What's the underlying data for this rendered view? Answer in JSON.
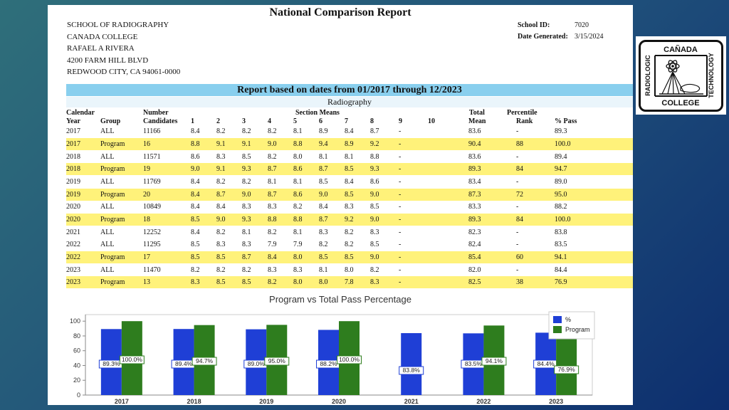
{
  "report": {
    "title": "National Comparison Report",
    "address": [
      "SCHOOL OF RADIOGRAPHY",
      "CANADA COLLEGE",
      "RAFAEL A RIVERA",
      "4200 FARM HILL BLVD",
      "REDWOOD CITY, CA 94061-0000"
    ],
    "school_id_label": "School ID:",
    "school_id": "7020",
    "date_label": "Date Generated:",
    "date": "3/15/2024",
    "banner": "Report based on dates from 01/2017 through 12/2023",
    "program_name": "Radiography"
  },
  "table": {
    "header_top": {
      "calendar": "Calendar",
      "number": "Number",
      "section_means": "Section Means",
      "total": "Total",
      "percentile": "Percentile"
    },
    "header_bottom": [
      "Year",
      "Group",
      "Candidates",
      "1",
      "2",
      "3",
      "4",
      "5",
      "6",
      "7",
      "8",
      "9",
      "10",
      "Mean",
      "Rank",
      "% Pass"
    ],
    "rows": [
      [
        "2017",
        "ALL",
        "11166",
        "8.4",
        "8.2",
        "8.2",
        "8.2",
        "8.1",
        "8.9",
        "8.4",
        "8.7",
        "-",
        "",
        "83.6",
        "-",
        "89.3"
      ],
      [
        "2017",
        "Program",
        "16",
        "8.8",
        "9.1",
        "9.1",
        "9.0",
        "8.8",
        "9.4",
        "8.9",
        "9.2",
        "-",
        "",
        "90.4",
        "88",
        "100.0"
      ],
      [
        "2018",
        "ALL",
        "11571",
        "8.6",
        "8.3",
        "8.5",
        "8.2",
        "8.0",
        "8.1",
        "8.1",
        "8.8",
        "-",
        "",
        "83.6",
        "-",
        "89.4"
      ],
      [
        "2018",
        "Program",
        "19",
        "9.0",
        "9.1",
        "9.3",
        "8.7",
        "8.6",
        "8.7",
        "8.5",
        "9.3",
        "-",
        "",
        "89.3",
        "84",
        "94.7"
      ],
      [
        "2019",
        "ALL",
        "11769",
        "8.4",
        "8.2",
        "8.2",
        "8.1",
        "8.1",
        "8.5",
        "8.4",
        "8.6",
        "-",
        "",
        "83.4",
        "-",
        "89.0"
      ],
      [
        "2019",
        "Program",
        "20",
        "8.4",
        "8.7",
        "9.0",
        "8.7",
        "8.6",
        "9.0",
        "8.5",
        "9.0",
        "-",
        "",
        "87.3",
        "72",
        "95.0"
      ],
      [
        "2020",
        "ALL",
        "10849",
        "8.4",
        "8.4",
        "8.3",
        "8.3",
        "8.2",
        "8.4",
        "8.3",
        "8.5",
        "-",
        "",
        "83.3",
        "-",
        "88.2"
      ],
      [
        "2020",
        "Program",
        "18",
        "8.5",
        "9.0",
        "9.3",
        "8.8",
        "8.8",
        "8.7",
        "9.2",
        "9.0",
        "-",
        "",
        "89.3",
        "84",
        "100.0"
      ],
      [
        "2021",
        "ALL",
        "12252",
        "8.4",
        "8.2",
        "8.1",
        "8.2",
        "8.1",
        "8.3",
        "8.2",
        "8.3",
        "-",
        "",
        "82.3",
        "-",
        "83.8"
      ],
      [
        "2022",
        "ALL",
        "11295",
        "8.5",
        "8.3",
        "8.3",
        "7.9",
        "7.9",
        "8.2",
        "8.2",
        "8.5",
        "-",
        "",
        "82.4",
        "-",
        "83.5"
      ],
      [
        "2022",
        "Program",
        "17",
        "8.5",
        "8.5",
        "8.7",
        "8.4",
        "8.0",
        "8.5",
        "8.5",
        "9.0",
        "-",
        "",
        "85.4",
        "60",
        "94.1"
      ],
      [
        "2023",
        "ALL",
        "11470",
        "8.2",
        "8.2",
        "8.2",
        "8.3",
        "8.3",
        "8.1",
        "8.0",
        "8.2",
        "-",
        "",
        "82.0",
        "-",
        "84.4"
      ],
      [
        "2023",
        "Program",
        "13",
        "8.3",
        "8.5",
        "8.5",
        "8.2",
        "8.0",
        "8.0",
        "7.8",
        "8.3",
        "-",
        "",
        "82.5",
        "38",
        "76.9"
      ]
    ]
  },
  "chart_data": {
    "type": "bar",
    "title": "Program vs Total Pass Percentage",
    "categories": [
      "2017",
      "2018",
      "2019",
      "2020",
      "2021",
      "2022",
      "2023"
    ],
    "series": [
      {
        "name": "%",
        "color": "#1f3fd6",
        "values": [
          89.3,
          89.4,
          89.0,
          88.2,
          83.8,
          83.5,
          84.4
        ],
        "labels": [
          "89.3%",
          "89.4%",
          "89.0%",
          "88.2%",
          "83.8%",
          "83.5%",
          "84.4%"
        ]
      },
      {
        "name": "Program",
        "color": "#2e7d1e",
        "values": [
          100.0,
          94.7,
          95.0,
          100.0,
          null,
          94.1,
          76.9
        ],
        "labels": [
          "100.0%",
          "94.7%",
          "95.0%",
          "100.0%",
          "",
          "94.1%",
          "76.9%"
        ]
      }
    ],
    "yticks": [
      0,
      20,
      40,
      60,
      80,
      100
    ],
    "ylim": [
      0,
      105
    ],
    "legend_position": "right"
  },
  "logo": {
    "top": "CAÑADA",
    "left": "RADIOLOGIC",
    "right": "TECHNOLOGY",
    "bottom": "COLLEGE"
  }
}
